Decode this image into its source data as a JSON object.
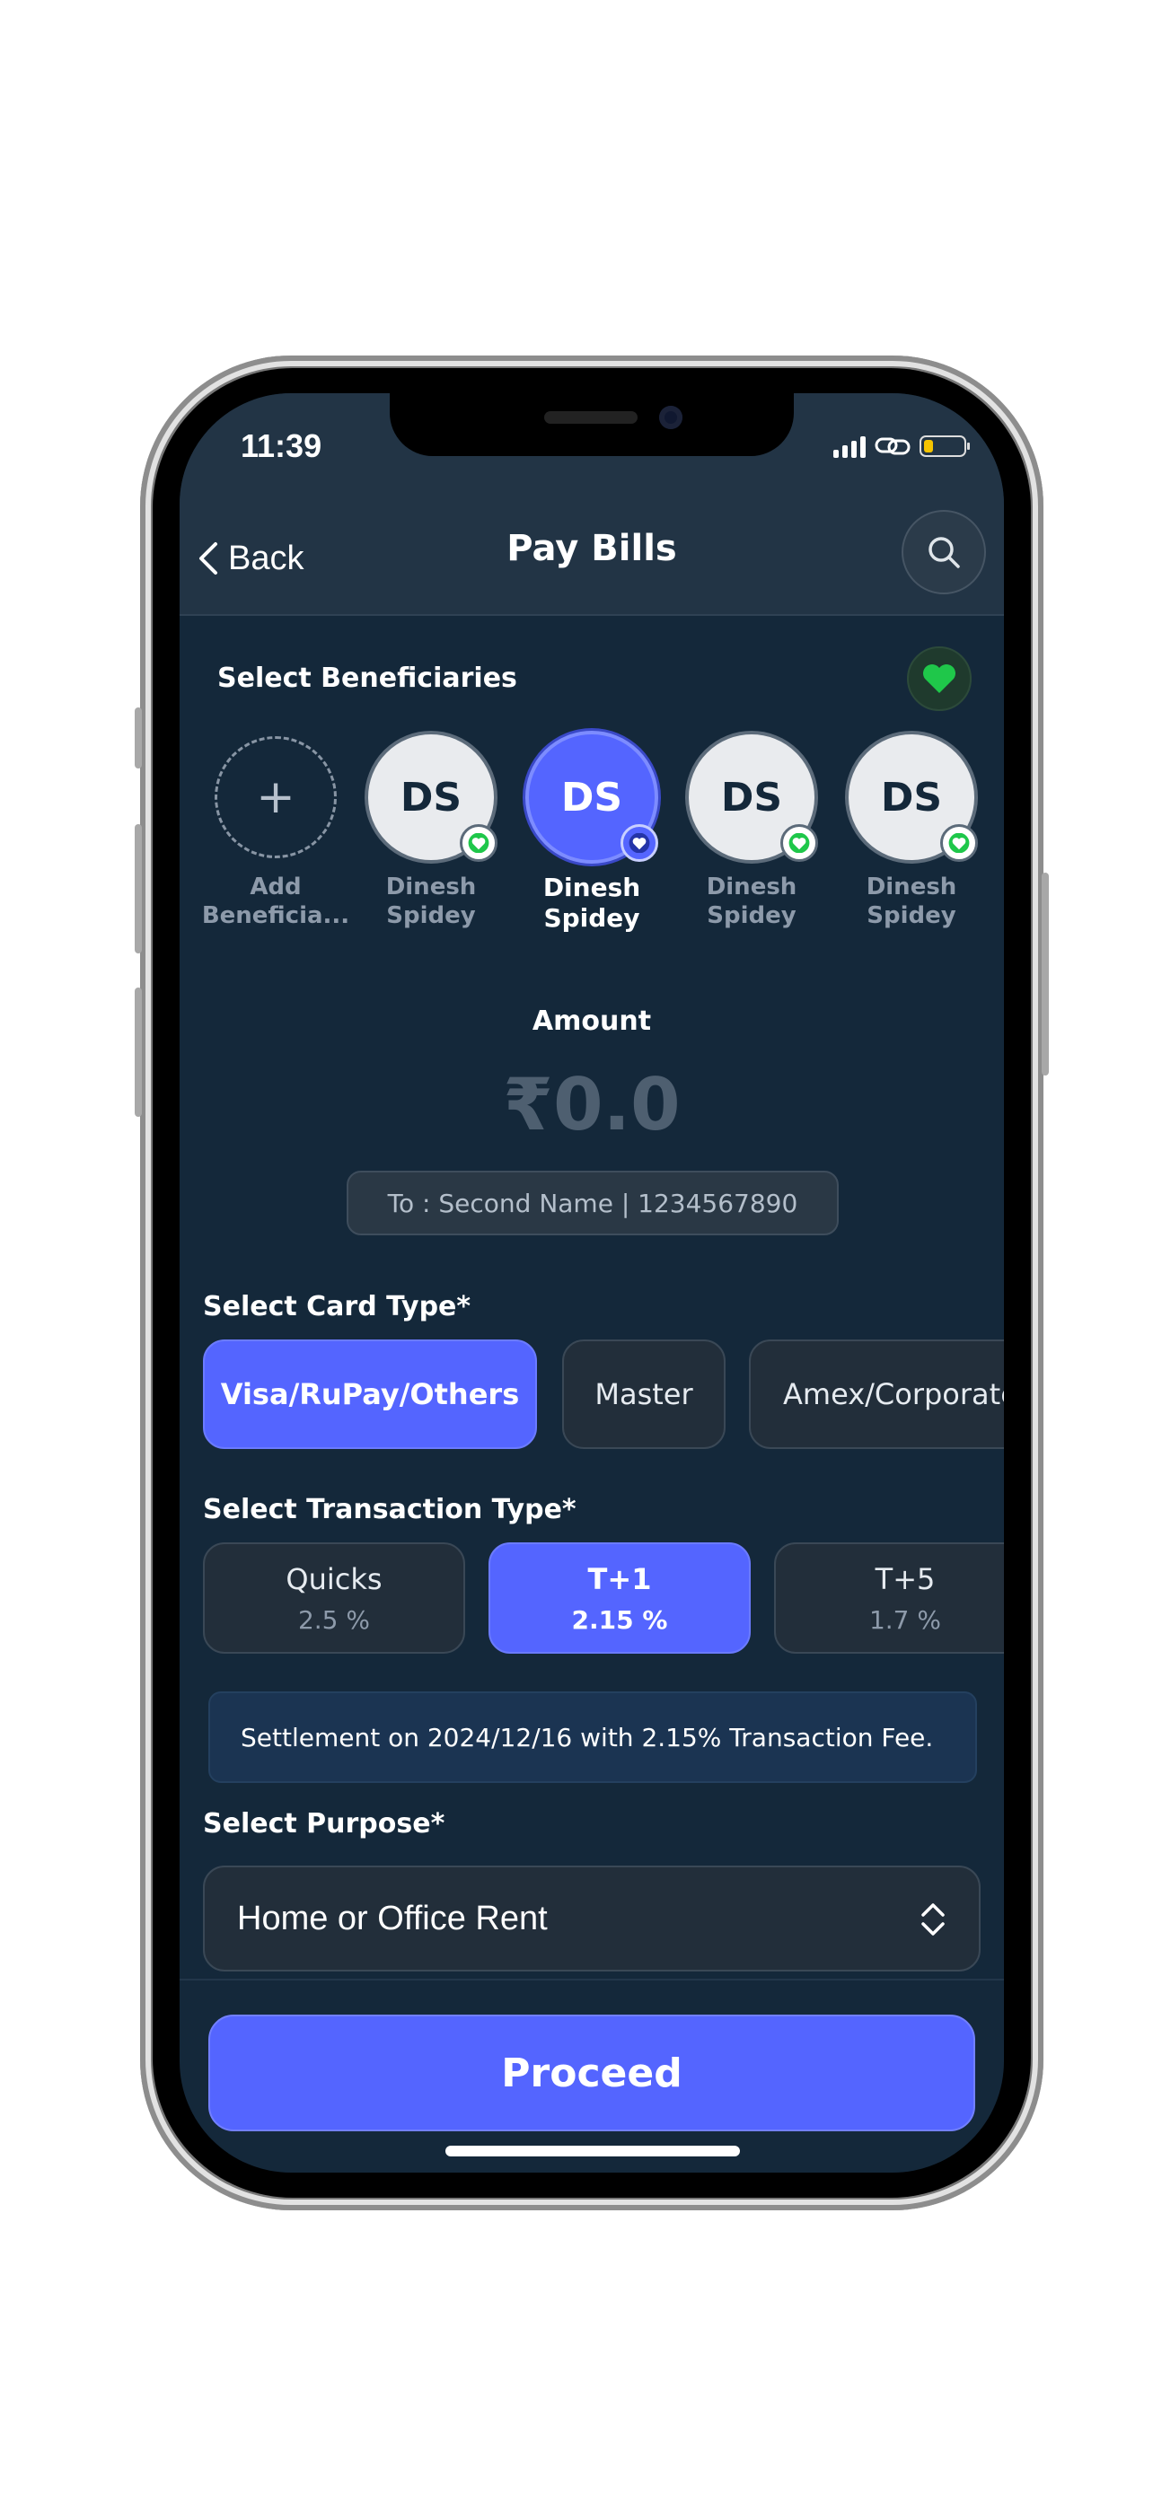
{
  "status_bar": {
    "time": "11:39"
  },
  "header": {
    "back_label": "Back",
    "title": "Pay Bills"
  },
  "beneficiaries": {
    "title": "Select Beneficiaries",
    "add_label": "Add Beneficia...",
    "add_symbol": "+",
    "items": [
      {
        "initials": "DS",
        "name_line1": "Dinesh",
        "name_line2": "Spidey",
        "selected": false
      },
      {
        "initials": "DS",
        "name_line1": "Dinesh",
        "name_line2": "Spidey",
        "selected": true
      },
      {
        "initials": "DS",
        "name_line1": "Dinesh",
        "name_line2": "Spidey",
        "selected": false
      },
      {
        "initials": "DS",
        "name_line1": "Dinesh",
        "name_line2": "Spidey",
        "selected": false
      }
    ]
  },
  "amount": {
    "label": "Amount",
    "value": "₹0.0",
    "to_text": "To : Second Name | 1234567890"
  },
  "card_type": {
    "title": "Select Card Type*",
    "options": [
      "Visa/RuPay/Others",
      "Master",
      "Amex/Corporate"
    ],
    "selected": "Visa/RuPay/Others"
  },
  "transaction_type": {
    "title": "Select Transaction Type*",
    "options": [
      {
        "label": "Quicks",
        "fee": "2.5 %"
      },
      {
        "label": "T+1",
        "fee": "2.15 %"
      },
      {
        "label": "T+5",
        "fee": "1.7 %"
      }
    ],
    "selected": "T+1"
  },
  "settlement_note": "Settlement on 2024/12/16 with 2.15% Transaction Fee.",
  "purpose": {
    "title": "Select Purpose*",
    "value": "Home or Office Rent"
  },
  "proceed_label": "Proceed",
  "colors": {
    "accent": "#5465ff",
    "background": "#14283a",
    "favorite": "#1fc74a"
  },
  "icons": [
    "chevron-left-icon",
    "search-icon",
    "heart-icon",
    "plus-icon",
    "chevron-updown-icon"
  ]
}
